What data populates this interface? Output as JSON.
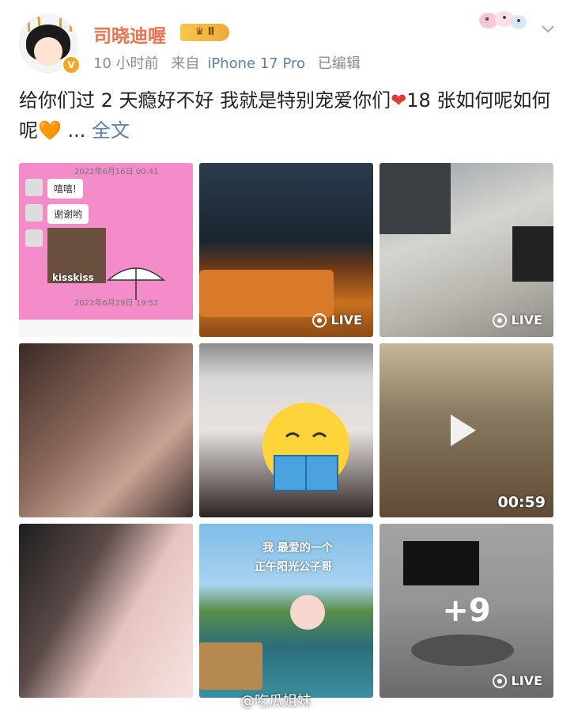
{
  "header": {
    "username": "司晓迪喔",
    "member_badge": "Ⅱ",
    "time": "10 小时前",
    "source_prefix": "来自",
    "source_device": "iPhone 17 Pro",
    "edited": "已编辑"
  },
  "post": {
    "text_part1": "给你们过 2 天瘾好不好 我就是特别宠爱你们",
    "text_part2": "18 张如何呢如何呢",
    "ellipsis": " ... ",
    "more_link": "全文",
    "heart_red": "❤",
    "heart_orange": "🧡"
  },
  "grid": {
    "cells": [
      {
        "kind": "screenshot"
      },
      {
        "kind": "photo",
        "live_label": "LIVE"
      },
      {
        "kind": "photo",
        "live_label": "LIVE"
      },
      {
        "kind": "photo"
      },
      {
        "kind": "photo"
      },
      {
        "kind": "video",
        "duration": "00:59"
      },
      {
        "kind": "photo"
      },
      {
        "kind": "photo"
      },
      {
        "kind": "photo",
        "more": "+9",
        "live_label": "LIVE"
      }
    ],
    "chat": {
      "date1": "2022年6月16日 00:41",
      "msg1": "嘻嘻!",
      "msg2": "谢谢哟",
      "sticker": "kisskiss",
      "date2": "2022年6月29日 19:52"
    },
    "pool_caption_line1": "我 最爱的一个",
    "pool_caption_line2": "正午阳光公子哥"
  },
  "watermark": "@吃瓜姐妹",
  "colors": {
    "username": "#eb7350",
    "link": "#5d7fa8",
    "meta": "#8c8c8c"
  }
}
